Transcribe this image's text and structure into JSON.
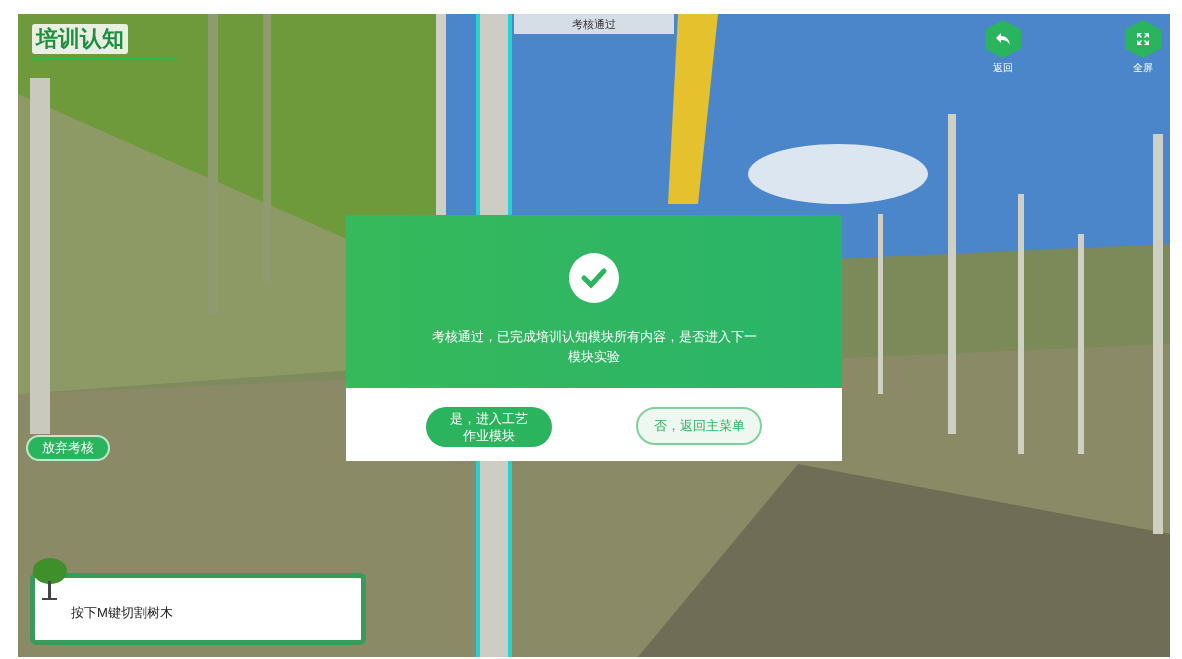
{
  "module_title": "培训认知",
  "status_banner": "考核通过",
  "top_buttons": [
    {
      "kind": "back",
      "label": "返回"
    },
    {
      "kind": "fullscreen",
      "label": "全屏"
    }
  ],
  "quit_button": "放弃考核",
  "dialog": {
    "message": "考核通过，已完成培训认知模块所有内容，是否进入下一模块实验",
    "buttons": [
      {
        "label": "是，进入工艺作业模块",
        "kind": "primary"
      },
      {
        "label": "否，返回主菜单",
        "kind": "secondary"
      }
    ]
  },
  "hint": "按下M键切割树木"
}
